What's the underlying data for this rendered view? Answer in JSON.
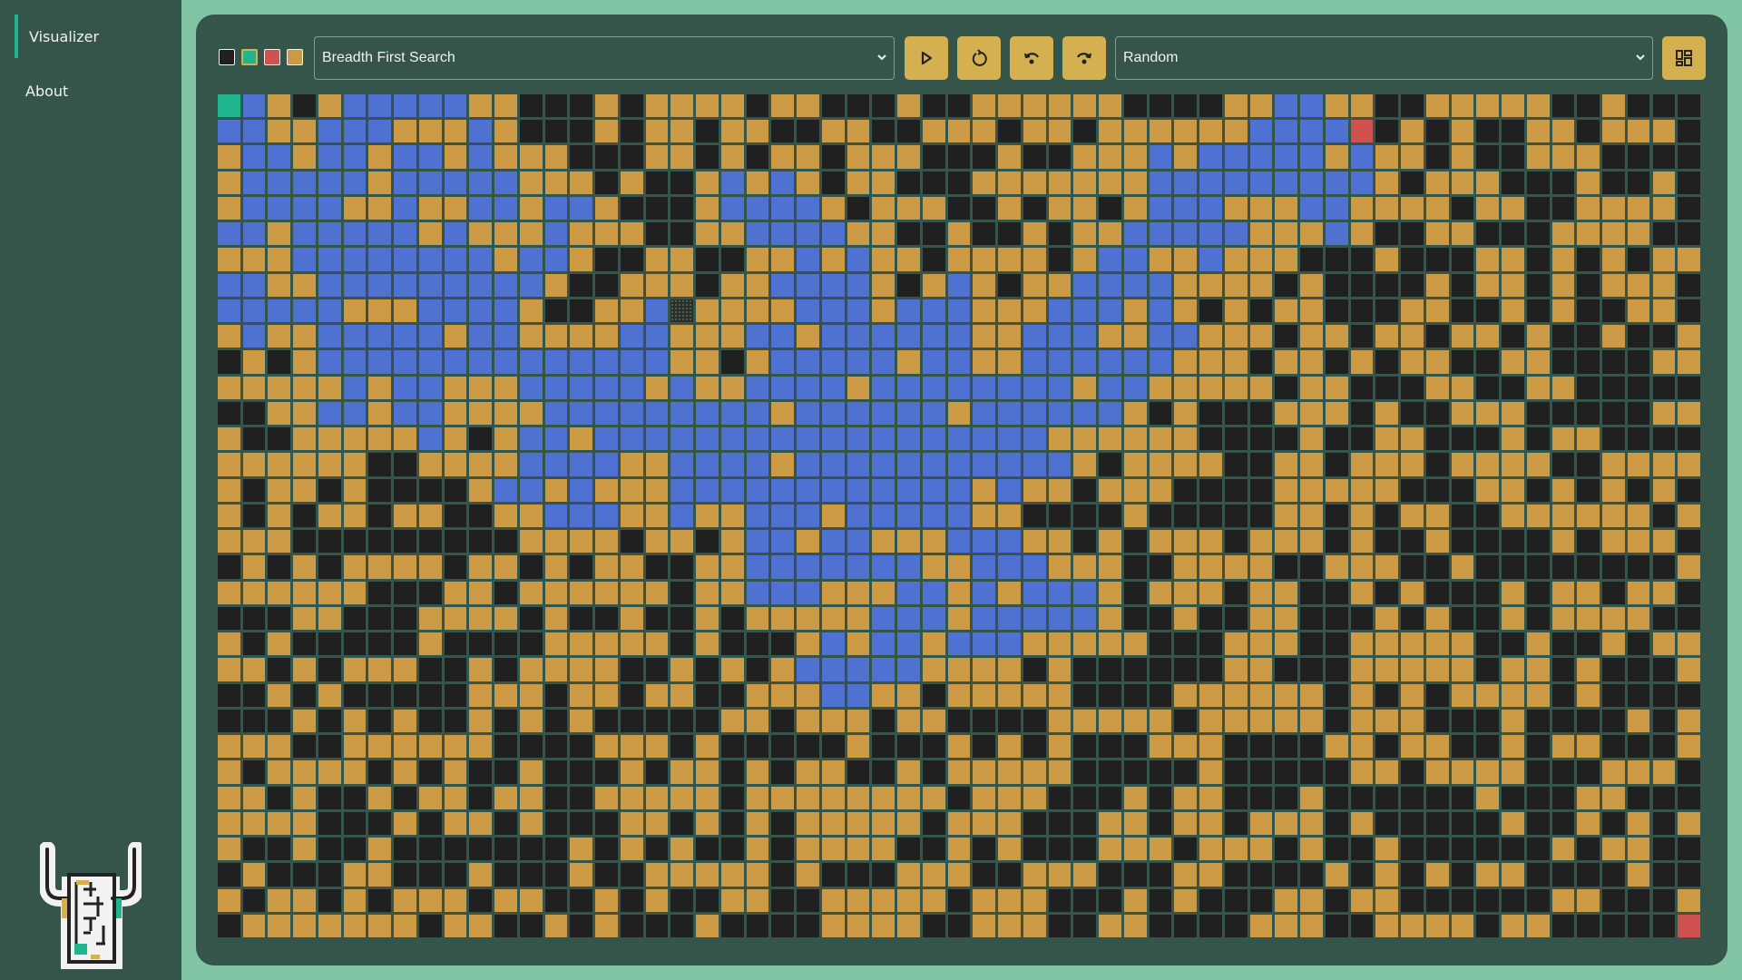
{
  "sidebar": {
    "items": [
      {
        "label": "Visualizer",
        "active": true
      },
      {
        "label": "About",
        "active": false
      }
    ],
    "logo_icon": "maze-robot-logo"
  },
  "toolbar": {
    "swatches": [
      {
        "name": "wall",
        "color": "#202020",
        "selected": false
      },
      {
        "name": "start",
        "color": "#1fb58f",
        "selected": true
      },
      {
        "name": "end",
        "color": "#d15151",
        "selected": false
      },
      {
        "name": "open",
        "color": "#cc9a45",
        "selected": false
      }
    ],
    "algorithm_select": {
      "value": "Breadth First Search"
    },
    "buttons": [
      {
        "name": "play",
        "icon": "play-icon"
      },
      {
        "name": "reset",
        "icon": "reset-icon"
      },
      {
        "name": "undo",
        "icon": "undo-icon"
      },
      {
        "name": "redo",
        "icon": "redo-icon"
      }
    ],
    "maze_select": {
      "value": "Random"
    },
    "generate_button": {
      "icon": "grid-layout-icon"
    }
  },
  "colors": {
    "W": "#202020",
    "O": "#cc9a45",
    "B": "#4f72d2",
    "S": "#1fb58f",
    "R": "#d15151",
    "X": "#2a2f2c",
    "accent": "#d4b050"
  },
  "grid": {
    "cols": 59,
    "rows_count": 33,
    "legend": {
      "W": "wall",
      "O": "open",
      "B": "visited",
      "S": "start",
      "R": "end",
      "X": "wall-hover"
    },
    "rows": [
      "SBOWOBBBBBOOWWWOWOOOOWOOWWWOWWOOOOOOWWWWOOBBOOWWOOOOOWWOWWW",
      "BBOOBBBOOOBOWWWOWOOWOOWWOOWWOOOWOOWOOOOOOBBBBRWOWOWWOOWOOOW",
      "OBBOBBOBBOBOOOWWWOOWOWOOWOOOWWWOWWOOOBOBBBBBOBOOWOWWOOOWWWW",
      "OBBBBBOBBBBBOOOWOWWOBOBOWOOWWWOOOOOOOBBBBBBBBBOWOOOWWWOWWOW",
      "OBBBBOOBOOBBOBBOWWWOBBBBOWOOOWWOWOOWOBBBOOOBBOOOOWOOWWOOOOW",
      "BBOBBBBBOBOOOBOOOWWOOBBBBOOWWOWWOWOOBBBBBOOOBOWWOOWWWOOOOWW",
      "OOOBBBBBBBBOBBOWWOOWWOOBOBOOWOOOOWOBBOOBOOOWWWOWWWOOWOWOWOO",
      "BBOOBBBBBBBBBOWWOOOWOOBBBBOWOBOWOOBBBBOOOOWOWWWWOWOOWOWOOOW",
      "BBBBBOOOBBBBOWWOOBXOOOOBBBOBBBOOOBBBOBOWOWOOWWWOOWWOWOWWOOW",
      "OBOOBBBBBOBBOOOOBBOOOBBOBBBBBBOOBBBOOBBOOOWOOWOOWOOWOWWOWWO",
      "WOWOBBBBBBBBBBBBBBOOWOBBBBBOBBOOBBBBBBOOOWOOWOWOOWWOOWWWWOO",
      "OOOOOBOBBOOOBBBBBOBOOBBBBOBBBBBBBBOBBOOOOOWOOWWWOOWWOOWWWWW",
      "WWOOBBOBBOOOOBBBBBBBBBOBBBBBBOBBBBBBOWOWWWOOOWOWWOOOWWWWWOO",
      "OWWOOOOOBOWOBBOBBBBBBBBBBBBBBBBBBOOOOOOWWWWOWWOOWWWOWOOWWWW",
      "OOOOOOWWOOOOBBBBOOBBBBOBBBBBBBBBBBOWOOOOWWOOWOOOWOOOOWWOOOO",
      "OWOOWOWWWWOBBOBOOOBBBBBBBBBBBBOBOOWOOOWWWWOOOOOWWWOOWOWOWOW",
      "OWOWOOWOOWWOOBBBOOBOOBBBOBBBBBOOWWWWOWWWWWOOWOWOOWWOOOOOOWO",
      "OOOWWWWWWWWWOOOOWOOWOBBOBBOOOBBBOOWOWOOOWOOOWOWWOWWWWOWOOOW",
      "WOWOWOOOOWOOWOWOOWWOOBBBBBBBOOBBBOOOWWOOOOWWOOOWWOWWWWWWWWO",
      "OOOOOOWWWOOWOOOOOOWOOBBBOOOBBOBOBBBOWOOOWOOWWOWOWWWOWOOWOOW",
      "WWWOOWWWOOOOWOWWOWWOWOOOOOBBBOBBBBBOWWOWWOOWWWOWOWWOWOOOOWW",
      "OWOWWWWWOWWWWOOOOOWOWWWOBOBBOBBBOOOOOWWWOOOWWOOOOOWWOWWOWOO",
      "OOWOWOOOWWOWOOOOWWOWOWOBBBBBOOOOWOWWWWWWOOWWWOOOOOWOOWOWWWO",
      "WWOWOWWWWWOOOWOOWOOWWOOOBBOOWOOOOOWWWWOOOOOOWOWOWOOOOWOWWWW",
      "WWWOWOWOWWOWOWOWWWWWOOWOOOWOOWWWWOOOOOWOOOOOWOOOWWWOWWWWOWO",
      "OOOWWOOOOOOWWWWOOOWOWWWWWOWWWOWOWOWWWOOOWWWWOOWOOWWOWOOWWWO",
      "OWOOOOWOWOWWOWWWOWOOWOWOOWWOWOOOOOWWWWWOWWWWWOOWOOOOWWWOOOW",
      "OOWOWWOWOOWOOWWOOOOOWOOOOOOOOWOOOWWWOWOOWWWOWWWWWWOWWWOOWWW",
      "OOOOWWWOWOOWOWWWOOWOWOWOOOOOWOOOWWWOOWOOWOOOWOWWWWWOWWOWOWO",
      "OWWOWWOWWWWWWWOWOWOWWOWOOOOWWOWOWWWOOOWOOOWOWWOWWWWWWOWOOWW",
      "WOWWWOOWWWOWWWOWWOOOOOWOWWWOOOWWOOOWWWOOWWWWOWOWOWOOWWWWOWW",
      "OWOOWOWOOOWOOWWOWOWWOOWWOOOOOWOOOWWWOWOWWWOOWOOWWWWWWOOWWWO",
      "WOOOOOOOWOOWWOWOWWWOWWWWOOOOWWOOOWWOOWWWWOOOWWOOOOWOOWWWWWR"
    ]
  }
}
